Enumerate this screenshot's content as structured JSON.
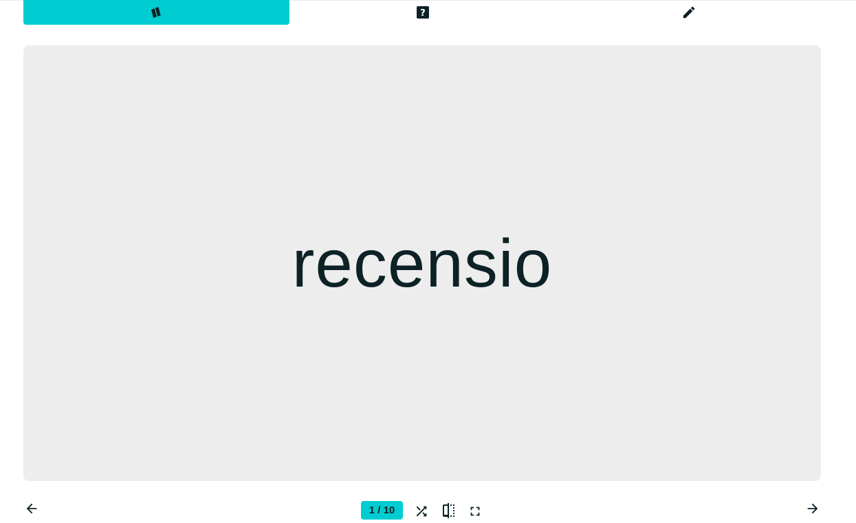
{
  "tabs": [
    {
      "name": "flashcards",
      "icon": "cards-icon",
      "active": true
    },
    {
      "name": "quiz",
      "icon": "question-box-icon",
      "active": false
    },
    {
      "name": "edit",
      "icon": "pencil-icon",
      "active": false
    }
  ],
  "card": {
    "term": "recensio"
  },
  "controls": {
    "counter": "1 / 10",
    "prev_icon": "arrow-left-icon",
    "next_icon": "arrow-right-icon",
    "shuffle_icon": "shuffle-icon",
    "flip_icon": "flip-icon",
    "fullscreen_icon": "fullscreen-icon"
  },
  "colors": {
    "accent": "#00cdd1",
    "card_bg": "#ededed",
    "text": "#0d2226"
  }
}
